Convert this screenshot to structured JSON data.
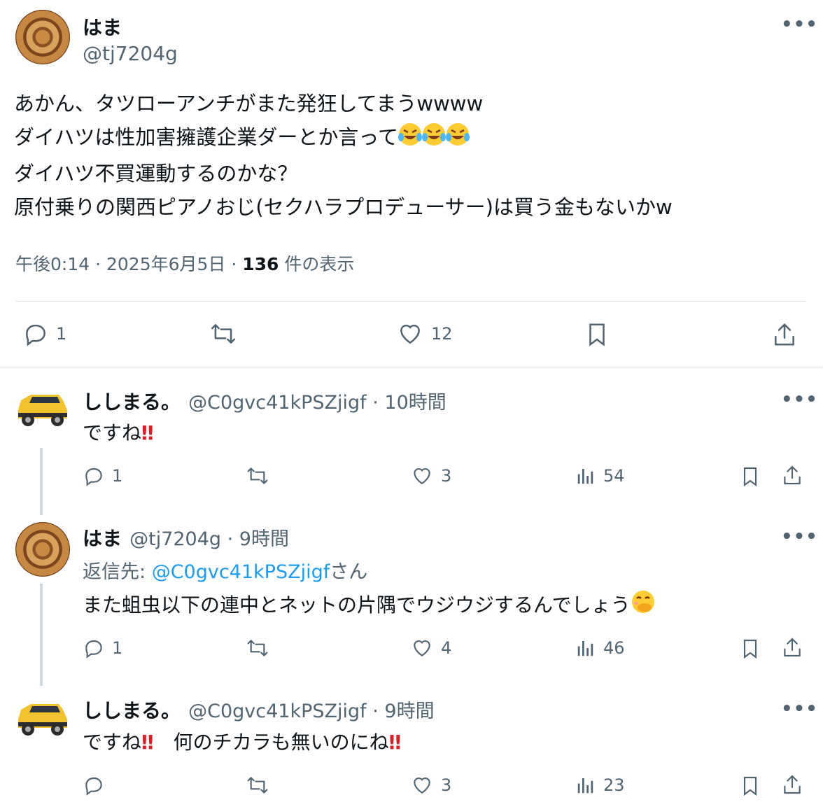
{
  "main": {
    "author_name": "はま",
    "author_handle": "@tj7204g",
    "lines": [
      "あかん、タツローアンチがまた発狂してまうwwww",
      "ダイハツは性加害擁護企業ダーとか言って",
      "ダイハツ不買運動するのかな？",
      "原付乗りの関西ピアノおじ(セクハラプロデューサー)は買う金もないかw"
    ],
    "line2_emoji": "laugh-cry-emoji x3",
    "time": "午後0:14 · 2025年6月5日 · ",
    "views_count": "136",
    "views_label": " 件の表示",
    "reply_count": "1",
    "like_count": "12"
  },
  "replies": [
    {
      "name": "ししまる。",
      "meta": "@C0gvc41kPSZjigf · 10時間",
      "text": "ですね",
      "reply": "1",
      "like": "3",
      "views": "54"
    },
    {
      "name": "はま",
      "meta": "@tj7204g · 9時間",
      "reply_to_label": "返信先: ",
      "reply_to_handle": "@C0gvc41kPSZjigf",
      "reply_to_suffix": "さん",
      "text": "また蛆虫以下の連中とネットの片隅でウジウジするんでしょう",
      "reply": "1",
      "like": "4",
      "views": "46"
    },
    {
      "name": "ししまる。",
      "meta": "@C0gvc41kPSZjigf · 9時間",
      "text_a": "ですね",
      "text_b": "　何のチカラも無いのにね",
      "reply": "",
      "like": "3",
      "views": "23"
    }
  ],
  "colors": {
    "text": "#0f1419",
    "secondary": "#536471",
    "link": "#1d9bf0",
    "divider": "#e1e6ea"
  }
}
